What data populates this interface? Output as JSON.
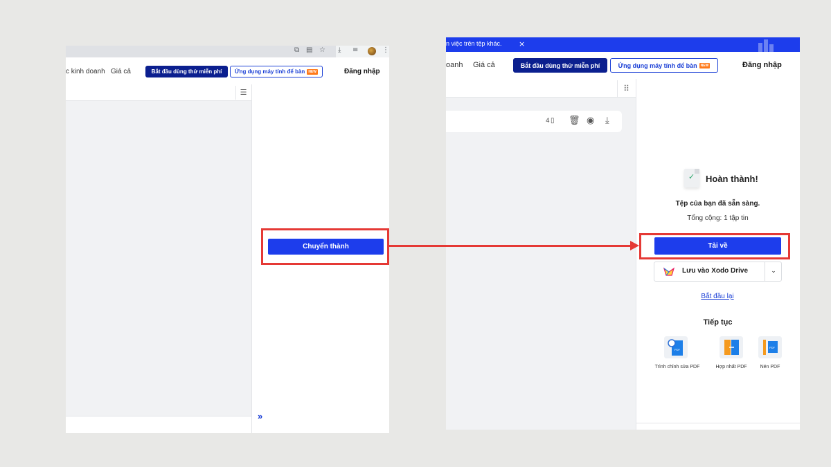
{
  "left_panel": {
    "nav": {
      "link_business": "c kinh doanh",
      "link_pricing": "Giá cả",
      "trial_button": "Bắt đầu dùng thử miễn phí",
      "desktop_app_button": "Ứng dụng máy tính để bàn",
      "new_badge": "NEW",
      "login": "Đăng nhập"
    },
    "convert_button": "Chuyển thành",
    "expand_glyph": "»"
  },
  "right_panel": {
    "banner_text": "n việc trên tệp khác.",
    "banner_close": "×",
    "nav": {
      "link_business": "oanh",
      "link_pricing": "Giá cả",
      "trial_button": "Bắt đầu dùng thử miễn phí",
      "desktop_app_button": "Ứng dụng máy tính để bàn",
      "new_badge": "NEW",
      "login": "Đăng nhập"
    },
    "file_card": {
      "page_count": "4"
    },
    "result": {
      "title": "Hoàn thành!",
      "subtitle": "Tệp của bạn đã sẵn sàng.",
      "total": "Tổng cộng: 1 tập tin",
      "download_button": "Tải về",
      "save_drive": "Lưu vào Xodo Drive",
      "restart": "Bắt đầu lại",
      "continue_heading": "Tiếp tục",
      "tools": [
        {
          "label": "Trình chỉnh sửa PDF",
          "icon": "pdf-editor-icon"
        },
        {
          "label": "Hợp nhất PDF",
          "icon": "merge-pdf-icon"
        },
        {
          "label": "Nén PDF",
          "icon": "compress-pdf-icon"
        }
      ]
    }
  },
  "annotation": {
    "color": "#e53935"
  }
}
